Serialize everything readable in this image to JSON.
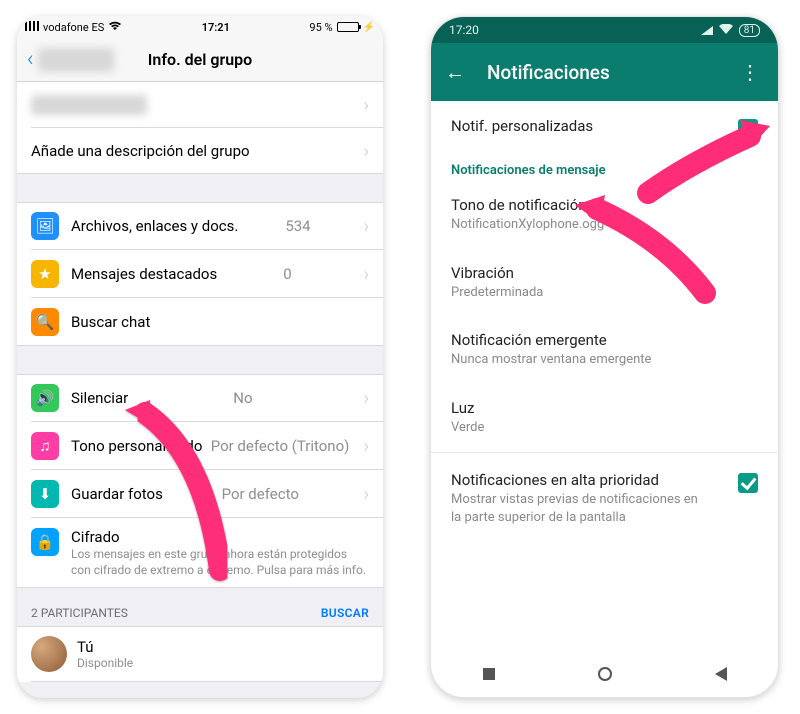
{
  "ios": {
    "status": {
      "carrier": "vodafone ES",
      "time": "17:21",
      "battery_pct": "95 %"
    },
    "nav_title": "Info. del grupo",
    "row_description": "Añade una descripción del grupo",
    "rows": {
      "files": {
        "label": "Archivos, enlaces y docs.",
        "detail": "534"
      },
      "starred": {
        "label": "Mensajes destacados",
        "detail": "0"
      },
      "search": {
        "label": "Buscar chat"
      },
      "mute": {
        "label": "Silenciar",
        "detail": "No"
      },
      "tone": {
        "label": "Tono personalizado",
        "detail": "Por defecto (Tritono)"
      },
      "save_photos": {
        "label": "Guardar fotos",
        "detail": "Por defecto"
      },
      "encryption": {
        "label": "Cifrado",
        "sub": "Los mensajes en este grupo ahora están protegidos con cifrado de extremo a extremo. Pulsa para más info."
      }
    },
    "participants_header": "2 PARTICIPANTES",
    "search_link": "BUSCAR",
    "me": {
      "name": "Tú",
      "status": "Disponible"
    }
  },
  "android": {
    "status": {
      "time": "17:20",
      "battery": "81"
    },
    "title": "Notificaciones",
    "rows": {
      "custom": {
        "label": "Notif. personalizadas"
      },
      "section_msg": "Notificaciones de mensaje",
      "tone": {
        "label": "Tono de notificación",
        "sub": "NotificationXylophone.ogg"
      },
      "vibration": {
        "label": "Vibración",
        "sub": "Predeterminada"
      },
      "popup": {
        "label": "Notificación emergente",
        "sub": "Nunca mostrar ventana emergente"
      },
      "light": {
        "label": "Luz",
        "sub": "Verde"
      },
      "high_priority": {
        "label": "Notificaciones en alta prioridad",
        "sub": "Mostrar vistas previas de notificaciones en la parte superior de la pantalla"
      }
    }
  }
}
